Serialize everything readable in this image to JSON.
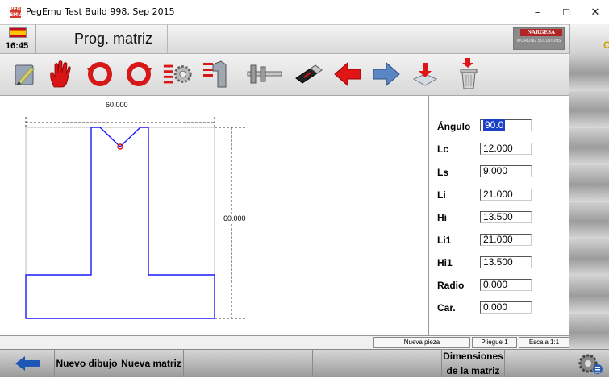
{
  "window": {
    "title": "PegEmu Test Build 998, Sep 2015",
    "app_icon_text": "PEG EMU",
    "minimize_glyph": "–",
    "maximize_glyph": "☐",
    "close_glyph": "✕"
  },
  "header": {
    "clock": "16:45",
    "view_title": "Prog. matriz",
    "logo_brand": "NARGESA",
    "logo_sub": "WORKING SOLUTIONS",
    "right_clip_text": "C"
  },
  "toolbar": {
    "tools": [
      "pencil-edit-icon",
      "hand-stop-icon",
      "rotate-left-icon",
      "rotate-right-icon",
      "gear-list-icon",
      "profile-tool-icon",
      "caliper-icon",
      "usb-drive-icon",
      "arrow-left-icon",
      "arrow-right-icon",
      "tray-download-icon",
      "trash-download-icon"
    ]
  },
  "drawing": {
    "width_dimension": "60.000",
    "height_dimension": "60.000",
    "profile_color": "#1a1aff",
    "marker_color": "#e01010"
  },
  "params": [
    {
      "label": "Ángulo",
      "value": "90.0",
      "selected": true
    },
    {
      "label": "Lc",
      "value": "12.000"
    },
    {
      "label": "Ls",
      "value": "9.000"
    },
    {
      "label": "Li",
      "value": "21.000"
    },
    {
      "label": "Hi",
      "value": "13.500"
    },
    {
      "label": "Li1",
      "value": "21.000"
    },
    {
      "label": "Hi1",
      "value": "13.500"
    },
    {
      "label": "Radio",
      "value": "0.000"
    },
    {
      "label": "Car.",
      "value": "0.000"
    }
  ],
  "status": {
    "piece": "Nueva pieza",
    "fold": "Pliegue 1",
    "scale": "Escala 1:1"
  },
  "bottom": {
    "new_drawing": "Nuevo dibujo",
    "new_die": "Nueva matriz",
    "die_dimensions_line1": "Dimensiones",
    "die_dimensions_line2": "de la matriz"
  },
  "colors": {
    "accent_red": "#e01010",
    "selection_blue": "#1c3fc7"
  }
}
